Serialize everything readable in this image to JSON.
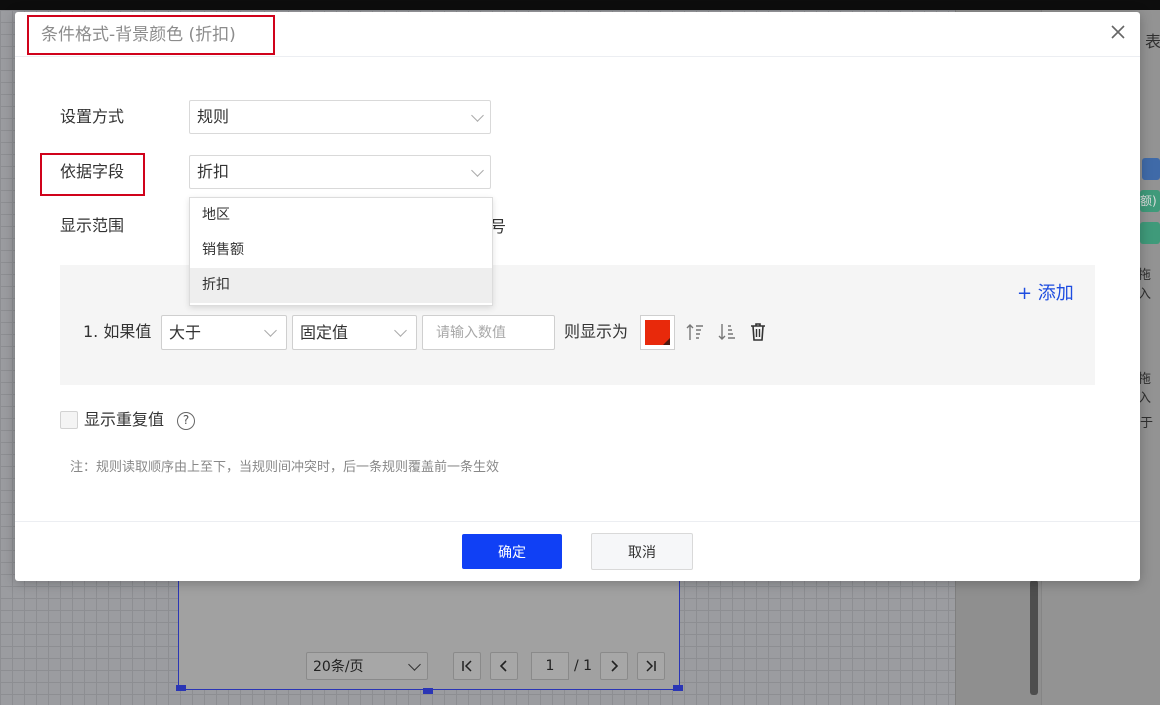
{
  "dialog": {
    "title": "条件格式-背景颜色 (折扣)",
    "close_icon": "close-icon",
    "setup_label": "设置方式",
    "setup_value": "规则",
    "field_label": "依据字段",
    "field_value": "折扣",
    "field_options": [
      "地区",
      "销售额",
      "折扣"
    ],
    "range_label": "显示范围",
    "range_tail": "号",
    "add_label": "+ 添加",
    "rule": {
      "number": "1. 如果值",
      "operator": "大于",
      "value_type": "固定值",
      "input_placeholder": "请输入数值",
      "then_label": "则显示为",
      "color": "#e8290b"
    },
    "show_duplicates_label": "显示重复值",
    "help_icon_glyph": "?",
    "note": "注：规则读取顺序由上至下，当规则间冲突时，后一条规则覆盖前一条生效",
    "ok_label": "确定",
    "cancel_label": "取消"
  },
  "background": {
    "right_panel_texts": [
      "表",
      "额)",
      "拖入",
      "拖入",
      "于"
    ],
    "pager": {
      "page_size": "20条/页",
      "current_page": "1",
      "total": "/ 1"
    }
  }
}
